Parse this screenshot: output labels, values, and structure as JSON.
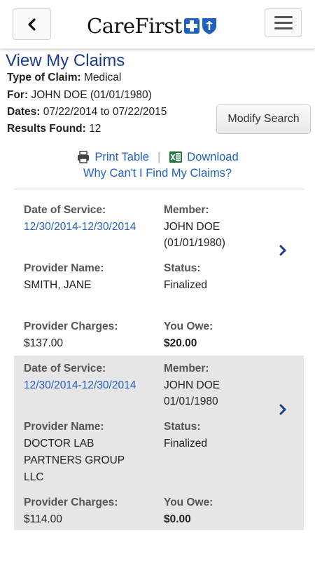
{
  "header": {
    "logo_text": "CareFirst",
    "back_icon": "chevron-left-icon",
    "menu_icon": "hamburger-menu-icon"
  },
  "page": {
    "title": "View My Claims",
    "type_label": "Type of Claim:",
    "type_value": "Medical",
    "for_label": "For:",
    "for_value": "JOHN DOE (01/01/1980)",
    "dates_label": "Dates:",
    "dates_value": "07/22/2014 to 07/22/2015",
    "results_label": "Results Found:",
    "results_value": "12",
    "modify_button": "Modify Search"
  },
  "links": {
    "print": "Print Table",
    "separator": "|",
    "download": "Download",
    "why": "Why Can't I Find My Claims?"
  },
  "labels": {
    "date_of_service": "Date of Service:",
    "member": "Member:",
    "provider_name": "Provider Name:",
    "status": "Status:",
    "provider_charges": "Provider Charges:",
    "you_owe": "You Owe:"
  },
  "claims": [
    {
      "date_of_service": "12/30/2014-12/30/2014",
      "member_name": "JOHN DOE",
      "member_dob": "(01/01/1980)",
      "provider_name": "SMITH, JANE",
      "status": "Finalized",
      "provider_charges": "$137.00",
      "you_owe": "$20.00"
    },
    {
      "date_of_service": "12/30/2014-12/30/2014",
      "member_name": "JOHN DOE",
      "member_dob": "01/01/1980",
      "provider_name_line1": "DOCTOR  LAB",
      "provider_name_line2": "PARTNERS GROUP",
      "provider_name_line3": "LLC",
      "status": "Finalized",
      "provider_charges": "$114.00",
      "you_owe": "$0.00"
    }
  ],
  "colors": {
    "brand_blue": "#1b3d8f",
    "link_blue": "#1f5fc0",
    "alt_row": "#e6e6e6"
  }
}
